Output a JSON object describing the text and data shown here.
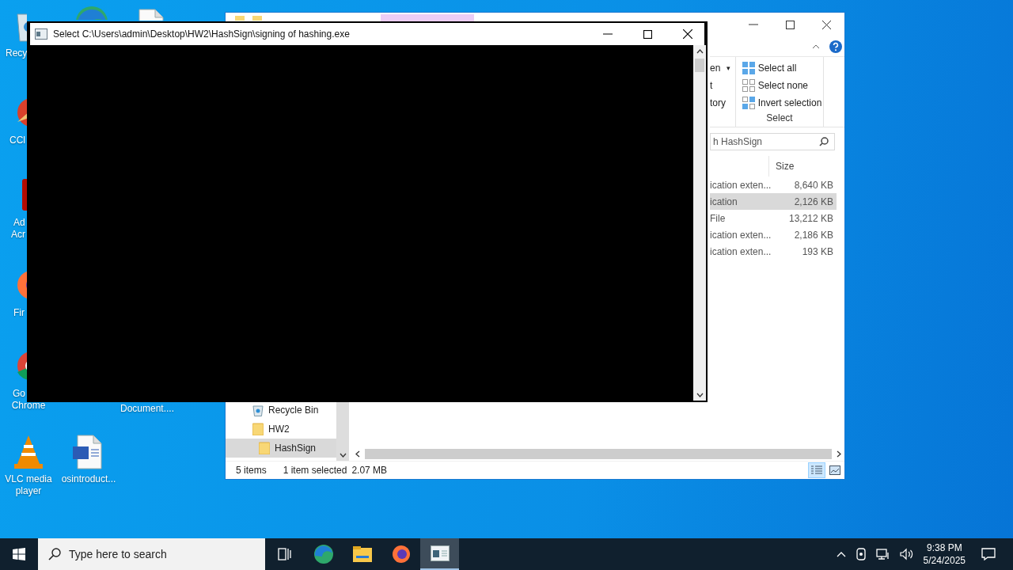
{
  "desktop_icons": [
    {
      "kind": "bin",
      "label": [
        "Recy"
      ]
    },
    {
      "kind": "edge"
    },
    {
      "kind": "doc"
    },
    {
      "kind": "ccleaner",
      "label": [
        "CCl"
      ]
    },
    {
      "kind": "adobe",
      "label": [
        "Ad",
        "Acr"
      ]
    },
    {
      "kind": "firefox",
      "label": [
        "Fir"
      ]
    },
    {
      "kind": "chrome",
      "label": [
        "Go",
        "Chrome"
      ]
    },
    {
      "kind": "none",
      "label": [
        "Document...."
      ]
    },
    {
      "kind": "vlc",
      "label": [
        "VLC media",
        "player"
      ]
    },
    {
      "kind": "word",
      "label": [
        "osintroduct..."
      ]
    }
  ],
  "explorer": {
    "ribbon_left": [
      {
        "label": "en",
        "arrow": "▾"
      },
      {
        "label": "t"
      },
      {
        "label": "tory"
      }
    ],
    "select_group": {
      "items": [
        {
          "label": "Select all",
          "kind": "all"
        },
        {
          "label": "Select none",
          "kind": "none"
        },
        {
          "label": "Invert selection",
          "kind": "invert"
        }
      ],
      "title": "Select"
    },
    "search": {
      "placeholder": "h HashSign"
    },
    "columns": [
      "Size"
    ],
    "rows": [
      {
        "type": "ication exten...",
        "size": "8,640 KB",
        "selected": false
      },
      {
        "type": "ication",
        "size": "2,126 KB",
        "selected": true
      },
      {
        "type": "File",
        "size": "13,212 KB",
        "selected": false
      },
      {
        "type": "ication exten...",
        "size": "2,186 KB",
        "selected": false
      },
      {
        "type": "ication exten...",
        "size": "193 KB",
        "selected": false
      }
    ],
    "nav": [
      {
        "label": "Recycle Bin",
        "kind": "bin",
        "selected": false
      },
      {
        "label": "HW2",
        "kind": "folder",
        "selected": false,
        "children": [
          {
            "label": "HashSign",
            "kind": "folder",
            "selected": true
          }
        ]
      }
    ],
    "status": {
      "count": "5 items",
      "selection": "1 item selected",
      "size": "2.07 MB"
    },
    "views": [
      {
        "kind": "details",
        "selected": true
      },
      {
        "kind": "tiles",
        "selected": false
      }
    ]
  },
  "console": {
    "title": "Select C:\\Users\\admin\\Desktop\\HW2\\HashSign\\signing of hashing.exe"
  },
  "taskbar": {
    "search_placeholder": "Type here to search",
    "apps": [
      {
        "kind": "taskview",
        "active": false
      },
      {
        "kind": "edge",
        "active": false
      },
      {
        "kind": "explorer",
        "active": false
      },
      {
        "kind": "firefox",
        "active": false
      },
      {
        "kind": "console",
        "active": true
      }
    ],
    "time": "9:38 PM",
    "date": "5/24/2025"
  }
}
